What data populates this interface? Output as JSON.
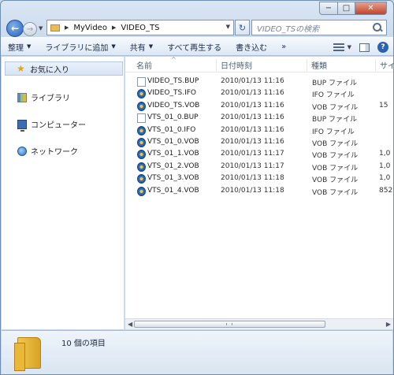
{
  "address_bar": {
    "crumbs": [
      "MyVideo",
      "VIDEO_TS"
    ]
  },
  "search": {
    "placeholder": "VIDEO_TSの検索"
  },
  "toolbar": {
    "organize": "整理",
    "add_to_library": "ライブラリに追加",
    "share": "共有",
    "play_all": "すべて再生する",
    "burn": "書き込む",
    "more": "»"
  },
  "navigation": {
    "favorites": "お気に入り",
    "libraries": "ライブラリ",
    "computer": "コンピューター",
    "network": "ネットワーク"
  },
  "columns": {
    "name": "名前",
    "date": "日付時刻",
    "type": "種類",
    "size": "サイ"
  },
  "files": [
    {
      "name": "VIDEO_TS.BUP",
      "date": "2010/01/13 11:16",
      "type": "BUP ファイル",
      "size": "",
      "icon": "document-icon"
    },
    {
      "name": "VIDEO_TS.IFO",
      "date": "2010/01/13 11:16",
      "type": "IFO ファイル",
      "size": "",
      "icon": "vlc-icon"
    },
    {
      "name": "VIDEO_TS.VOB",
      "date": "2010/01/13 11:16",
      "type": "VOB ファイル",
      "size": "15",
      "icon": "vlc-icon"
    },
    {
      "name": "VTS_01_0.BUP",
      "date": "2010/01/13 11:16",
      "type": "BUP ファイル",
      "size": "",
      "icon": "document-icon"
    },
    {
      "name": "VTS_01_0.IFO",
      "date": "2010/01/13 11:16",
      "type": "IFO ファイル",
      "size": "",
      "icon": "vlc-icon"
    },
    {
      "name": "VTS_01_0.VOB",
      "date": "2010/01/13 11:16",
      "type": "VOB ファイル",
      "size": "",
      "icon": "vlc-icon"
    },
    {
      "name": "VTS_01_1.VOB",
      "date": "2010/01/13 11:17",
      "type": "VOB ファイル",
      "size": "1,0",
      "icon": "vlc-icon"
    },
    {
      "name": "VTS_01_2.VOB",
      "date": "2010/01/13 11:17",
      "type": "VOB ファイル",
      "size": "1,0",
      "icon": "vlc-icon"
    },
    {
      "name": "VTS_01_3.VOB",
      "date": "2010/01/13 11:18",
      "type": "VOB ファイル",
      "size": "1,0",
      "icon": "vlc-icon"
    },
    {
      "name": "VTS_01_4.VOB",
      "date": "2010/01/13 11:18",
      "type": "VOB ファイル",
      "size": "852",
      "icon": "vlc-icon"
    }
  ],
  "details": {
    "item_count": "10 個の項目"
  },
  "caption_buttons": {
    "minimize": "−",
    "maximize": "□",
    "close": "✕"
  }
}
